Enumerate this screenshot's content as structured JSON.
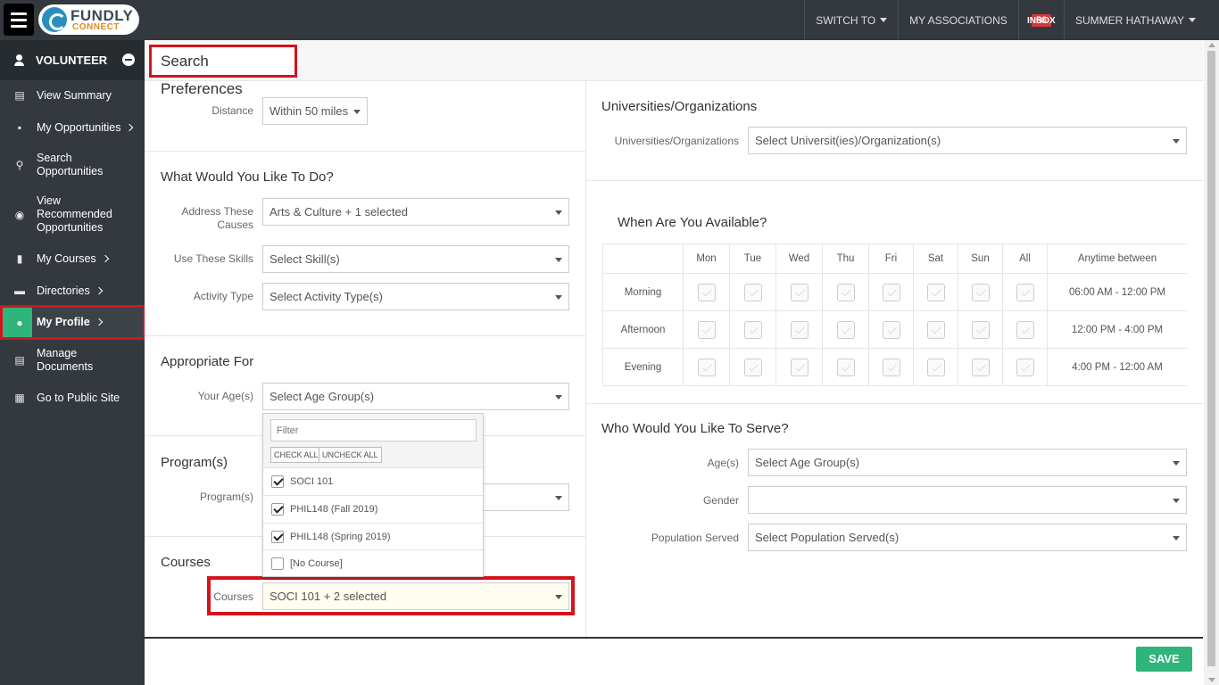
{
  "topbar": {
    "logo_text": "FUNDLY",
    "logo_subtext": "CONNECT",
    "nav": {
      "switch_to": "SWITCH TO",
      "my_associations": "MY ASSOCIATIONS",
      "inbox_count": "56",
      "inbox_label": "INBOX",
      "user_name": "SUMMER HATHAWAY"
    }
  },
  "sidebar": {
    "role": "VOLUNTEER",
    "items": [
      {
        "label": "View Summary",
        "icon": "list-icon"
      },
      {
        "label": "My Opportunities",
        "icon": "monitor-icon"
      },
      {
        "label": "Search Opportunities",
        "icon": "search-icon"
      },
      {
        "label": "View Recommended Opportunities",
        "icon": "eye-icon"
      },
      {
        "label": "My Courses",
        "icon": "book-icon"
      },
      {
        "label": "Directories",
        "icon": "folder-icon"
      },
      {
        "label": "My Profile",
        "icon": "user-icon",
        "active": true
      },
      {
        "label": "Manage Documents",
        "icon": "documents-icon"
      },
      {
        "label": "Go to Public Site",
        "icon": "globe-icon"
      }
    ]
  },
  "page": {
    "title": "Search Preferences",
    "distance": {
      "label": "Distance",
      "value": "Within 50 miles"
    },
    "what_to_do": {
      "title": "What Would You Like To Do?",
      "causes_label": "Address These Causes",
      "causes_value": "Arts & Culture + 1 selected",
      "skills_label": "Use These Skills",
      "skills_value": "Select Skill(s)",
      "activity_label": "Activity Type",
      "activity_value": "Select Activity Type(s)"
    },
    "appropriate_for": {
      "title": "Appropriate For",
      "age_label": "Your Age(s)",
      "age_value": "Select Age Group(s)"
    },
    "programs": {
      "title": "Program(s)",
      "label": "Program(s)"
    },
    "courses": {
      "title": "Courses",
      "label": "Courses",
      "value": "SOCI 101 + 2 selected",
      "dropdown": {
        "filter_placeholder": "Filter",
        "check_all": "CHECK ALL",
        "uncheck_all": "UNCHECK ALL",
        "options": [
          {
            "label": "SOCI 101",
            "checked": true
          },
          {
            "label": "PHIL148 (Fall 2019)",
            "checked": true
          },
          {
            "label": "PHIL148 (Spring 2019)",
            "checked": true
          },
          {
            "label": "[No Course]",
            "checked": false
          }
        ]
      }
    },
    "universities": {
      "title": "Universities/Organizations",
      "label": "Universities/Organizations",
      "value": "Select Universit(ies)/Organization(s)"
    },
    "availability": {
      "title": "When Are You Available?",
      "days": [
        "Mon",
        "Tue",
        "Wed",
        "Thu",
        "Fri",
        "Sat",
        "Sun",
        "All"
      ],
      "time_header": "Anytime between",
      "rows": [
        {
          "label": "Morning",
          "time": "06:00 AM - 12:00 PM"
        },
        {
          "label": "Afternoon",
          "time": "12:00 PM - 4:00 PM"
        },
        {
          "label": "Evening",
          "time": "4:00 PM - 12:00 AM"
        }
      ]
    },
    "serve": {
      "title": "Who Would You Like To Serve?",
      "ages_label": "Age(s)",
      "ages_value": "Select Age Group(s)",
      "gender_label": "Gender",
      "gender_value": "",
      "population_label": "Population Served",
      "population_value": "Select Population Served(s)"
    },
    "save_label": "SAVE"
  }
}
